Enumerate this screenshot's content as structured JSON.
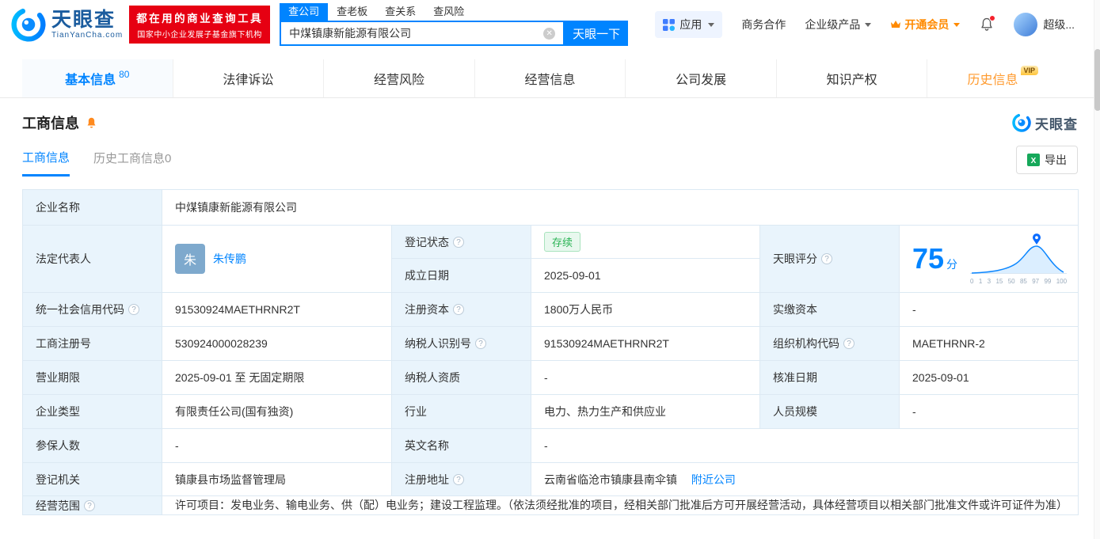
{
  "colors": {
    "accent_blue": "#0084ff",
    "brand_red": "#e60012",
    "vip_orange": "#ff8a00",
    "status_green": "#2bb355",
    "label_cell_bg": "#e9f4fc"
  },
  "icons": {
    "clear": "✕",
    "help": "?",
    "export_excel": "X"
  },
  "header": {
    "logo": {
      "brand": "天眼查",
      "domain": "TianYanCha.com"
    },
    "slogan": {
      "line1": "都在用的商业查询工具",
      "line2": "国家中小企业发展子基金旗下机构"
    },
    "search_tabs": [
      {
        "label": "查公司",
        "active": true
      },
      {
        "label": "查老板",
        "active": false
      },
      {
        "label": "查关系",
        "active": false
      },
      {
        "label": "查风险",
        "active": false
      }
    ],
    "search": {
      "value": "中煤镇康新能源有限公司",
      "button": "天眼一下"
    },
    "menu": {
      "apps": "应用",
      "cooperation": "商务合作",
      "enterprise": "企业级产品",
      "vip": "开通会员",
      "user": "超级..."
    }
  },
  "nav_tabs": [
    {
      "label": "基本信息",
      "count": "80"
    },
    {
      "label": "法律诉讼"
    },
    {
      "label": "经营风险"
    },
    {
      "label": "经营信息"
    },
    {
      "label": "公司发展"
    },
    {
      "label": "知识产权"
    },
    {
      "label": "历史信息",
      "badge": "VIP"
    }
  ],
  "section": {
    "title": "工商信息",
    "watermark": "天眼查",
    "tabs": [
      {
        "label": "工商信息",
        "active": true
      },
      {
        "label": "历史工商信息0",
        "active": false
      }
    ],
    "export_label": "导出"
  },
  "info": {
    "labels": {
      "company_name": "企业名称",
      "legal_rep": "法定代表人",
      "reg_status": "登记状态",
      "establish_date": "成立日期",
      "score": "天眼评分",
      "credit_code": "统一社会信用代码",
      "reg_capital": "注册资本",
      "paid_capital": "实缴资本",
      "reg_number": "工商注册号",
      "taxpayer_id": "纳税人识别号",
      "org_code": "组织机构代码",
      "business_term": "营业期限",
      "taxpayer_qual": "纳税人资质",
      "approval_date": "核准日期",
      "company_type": "企业类型",
      "industry": "行业",
      "staff_size": "人员规模",
      "insured_count": "参保人数",
      "english_name": "英文名称",
      "reg_authority": "登记机关",
      "reg_address": "注册地址",
      "business_scope": "经营范围"
    },
    "values": {
      "company_name": "中煤镇康新能源有限公司",
      "legal_rep_avatar": "朱",
      "legal_rep": "朱传鹏",
      "reg_status": "存续",
      "establish_date": "2025-09-01",
      "credit_code": "91530924MAETHRNR2T",
      "reg_capital": "1800万人民币",
      "paid_capital": "-",
      "reg_number": "530924000028239",
      "taxpayer_id": "91530924MAETHRNR2T",
      "org_code": "MAETHRNR-2",
      "business_term": "2025-09-01 至 无固定期限",
      "taxpayer_qual": "-",
      "approval_date": "2025-09-01",
      "company_type": "有限责任公司(国有独资)",
      "industry": "电力、热力生产和供应业",
      "staff_size": "-",
      "insured_count": "-",
      "english_name": "-",
      "reg_authority": "镇康县市场监督管理局",
      "reg_address": "云南省临沧市镇康县南伞镇",
      "nearby_link": "附近公司",
      "business_scope": "许可项目：发电业务、输电业务、供（配）电业务；建设工程监理。（依法须经批准的项目，经相关部门批准后方可开展经营活动，具体经营项目以相关部门批准文件或许可证件为准）"
    },
    "score": {
      "value": "75",
      "unit": "分",
      "ticks": [
        "0",
        "1",
        "3",
        "15",
        "50",
        "85",
        "97",
        "99",
        "100"
      ]
    }
  }
}
